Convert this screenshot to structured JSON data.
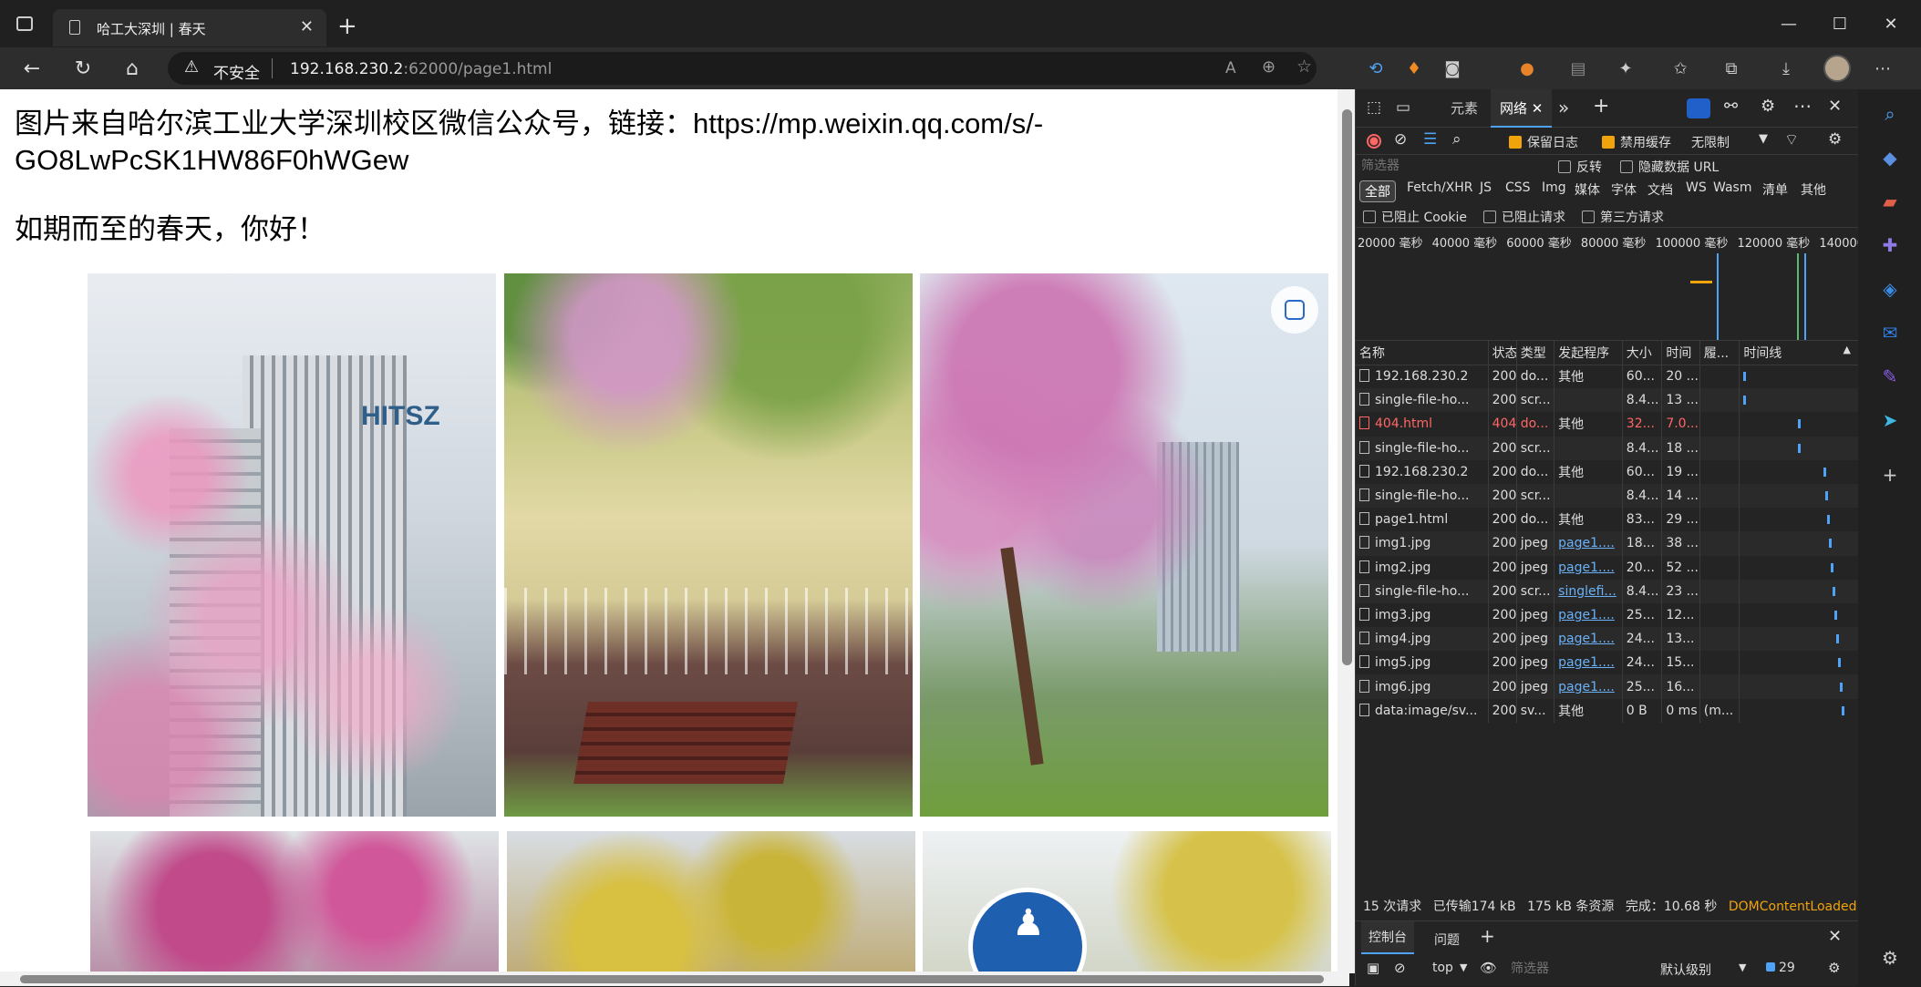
{
  "browser": {
    "tab_title": "哈工大深圳 | 春天",
    "address": {
      "security_label": "不安全",
      "host": "192.168.230.2",
      "path": ":62000/page1.html"
    }
  },
  "page": {
    "heading": "图片来自哈尔滨工业大学深圳校区微信公众号，链接：https://mp.weixin.qq.com/s/-GO8LwPcSK1HW86F0hWGew",
    "subheading": "如期而至的春天，你好！",
    "photos": [
      "img1.jpg",
      "img2.jpg",
      "img3.jpg",
      "img4.jpg",
      "img5.jpg",
      "img6.jpg"
    ]
  },
  "devtools": {
    "tabs": [
      "元素",
      "网络"
    ],
    "toolbar": {
      "preserve_log": "保留日志",
      "disable_cache": "禁用缓存",
      "throttling": "无限制"
    },
    "filter": {
      "placeholder": "筛选器",
      "invert": "反转",
      "hide_data_urls": "隐藏数据 URL",
      "types": [
        "全部",
        "Fetch/XHR",
        "JS",
        "CSS",
        "Img",
        "媒体",
        "字体",
        "文档",
        "WS",
        "Wasm",
        "清单",
        "其他"
      ],
      "blocked_cookies": "已阻止 Cookie",
      "blocked_requests": "已阻止请求",
      "third_party": "第三方请求"
    },
    "overview_ticks": [
      "20000 毫秒",
      "40000 毫秒",
      "60000 毫秒",
      "80000 毫秒",
      "100000 毫秒",
      "120000 毫秒",
      "140000"
    ],
    "columns": [
      "名称",
      "状态",
      "类型",
      "发起程序",
      "大小",
      "时间",
      "履...",
      "时间线"
    ],
    "rows": [
      {
        "name": "192.168.230.2",
        "status": "200",
        "type": "do...",
        "initiator": "其他",
        "size": "60...",
        "time": "20 ...",
        "err": false,
        "link": false
      },
      {
        "name": "single-file-ho...",
        "status": "200",
        "type": "scr...",
        "initiator": "",
        "size": "8.4...",
        "time": "13 ...",
        "err": false,
        "link": false
      },
      {
        "name": "404.html",
        "status": "404",
        "type": "do...",
        "initiator": "其他",
        "size": "32...",
        "time": "7.0...",
        "err": true,
        "link": false
      },
      {
        "name": "single-file-ho...",
        "status": "200",
        "type": "scr...",
        "initiator": "",
        "size": "8.4...",
        "time": "18 ...",
        "err": false,
        "link": false
      },
      {
        "name": "192.168.230.2",
        "status": "200",
        "type": "do...",
        "initiator": "其他",
        "size": "60...",
        "time": "19 ...",
        "err": false,
        "link": false
      },
      {
        "name": "single-file-ho...",
        "status": "200",
        "type": "scr...",
        "initiator": "",
        "size": "8.4...",
        "time": "14 ...",
        "err": false,
        "link": false
      },
      {
        "name": "page1.html",
        "status": "200",
        "type": "do...",
        "initiator": "其他",
        "size": "83...",
        "time": "29 ...",
        "err": false,
        "link": false
      },
      {
        "name": "img1.jpg",
        "status": "200",
        "type": "jpeg",
        "initiator": "page1....",
        "size": "18...",
        "time": "38 ...",
        "err": false,
        "link": true
      },
      {
        "name": "img2.jpg",
        "status": "200",
        "type": "jpeg",
        "initiator": "page1....",
        "size": "20...",
        "time": "52 ...",
        "err": false,
        "link": true
      },
      {
        "name": "single-file-ho...",
        "status": "200",
        "type": "scr...",
        "initiator": "singlefi...",
        "size": "8.4...",
        "time": "23 ...",
        "err": false,
        "link": true
      },
      {
        "name": "img3.jpg",
        "status": "200",
        "type": "jpeg",
        "initiator": "page1....",
        "size": "25...",
        "time": "12...",
        "err": false,
        "link": true
      },
      {
        "name": "img4.jpg",
        "status": "200",
        "type": "jpeg",
        "initiator": "page1....",
        "size": "24...",
        "time": "13...",
        "err": false,
        "link": true
      },
      {
        "name": "img5.jpg",
        "status": "200",
        "type": "jpeg",
        "initiator": "page1....",
        "size": "24...",
        "time": "15...",
        "err": false,
        "link": true
      },
      {
        "name": "img6.jpg",
        "status": "200",
        "type": "jpeg",
        "initiator": "page1....",
        "size": "25...",
        "time": "16...",
        "err": false,
        "link": true
      },
      {
        "name": "data:image/sv...",
        "status": "200",
        "type": "sv...",
        "initiator": "其他",
        "size": "0 B",
        "time": "0 ms",
        "fulfilled": "(m...",
        "err": false,
        "link": false
      }
    ],
    "summary": {
      "requests": "15 次请求",
      "transferred": "已传输174 kB",
      "resources": "175 kB 条资源",
      "finish": "完成：10.68 秒",
      "dom_loaded": "DOMContentLoaded："
    },
    "drawer": {
      "tabs": [
        "控制台",
        "问题"
      ],
      "context": "top",
      "filter_placeholder": "筛选器",
      "level": "默认级别",
      "issues_count": "29"
    }
  },
  "colors": {
    "accent": "#4fa3f7",
    "warning": "#f0a30a",
    "error": "#ff6666"
  }
}
